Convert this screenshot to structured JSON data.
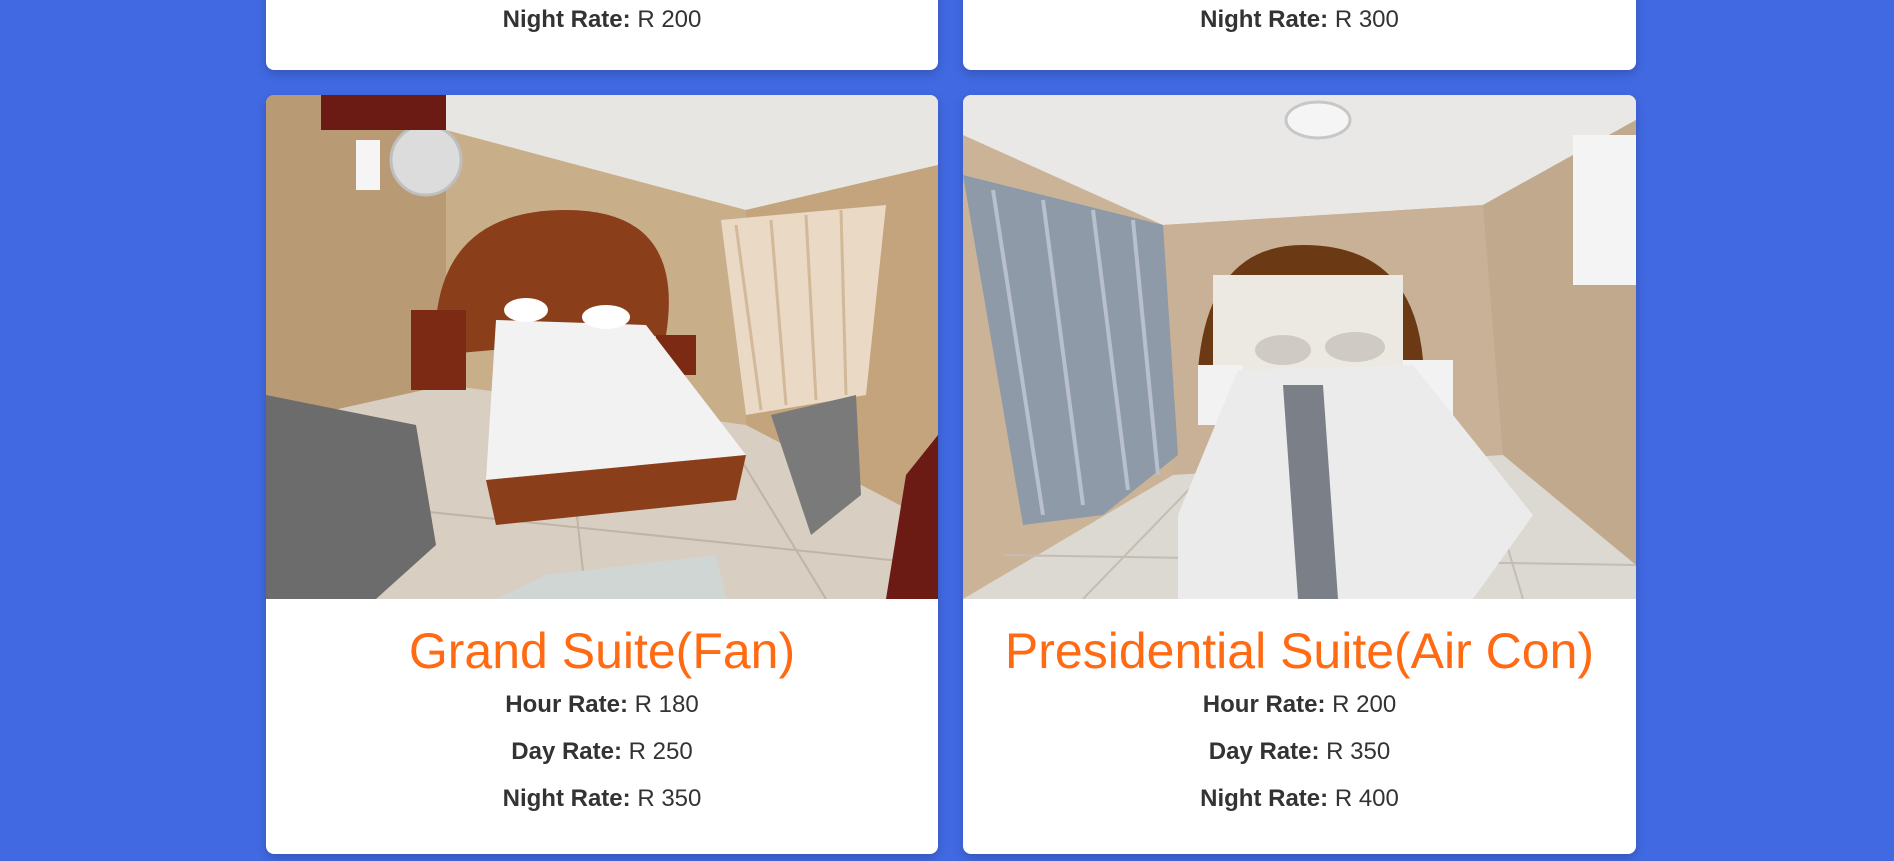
{
  "rooms_previous": [
    {
      "night_label": "Night Rate:",
      "night_value": "R 200"
    },
    {
      "night_label": "Night Rate:",
      "night_value": "R 300"
    }
  ],
  "rooms": [
    {
      "title": "Grand Suite(Fan)",
      "hour_label": "Hour Rate:",
      "hour_value": "R 180",
      "day_label": "Day Rate:",
      "day_value": "R 250",
      "night_label": "Night Rate:",
      "night_value": "R 350"
    },
    {
      "title": "Presidential Suite(Air Con)",
      "hour_label": "Hour Rate:",
      "hour_value": "R 200",
      "day_label": "Day Rate:",
      "day_value": "R 350",
      "night_label": "Night Rate:",
      "night_value": "R 400"
    }
  ],
  "colors": {
    "background": "#4169e1",
    "title_accent": "#ff6a13",
    "text": "#333333"
  }
}
